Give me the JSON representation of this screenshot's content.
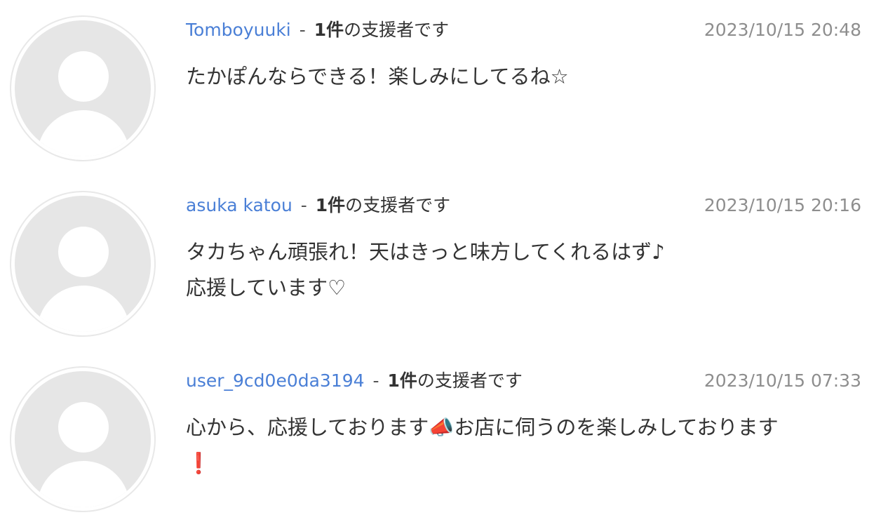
{
  "comments": [
    {
      "username": "Tomboyuuki",
      "separator": "-",
      "count": "1件",
      "supporter_suffix": "の支援者です",
      "timestamp": "2023/10/15 20:48",
      "lines": [
        "たかぽんならできる！楽しみにしてるね☆"
      ]
    },
    {
      "username": "asuka katou",
      "separator": "-",
      "count": "1件",
      "supporter_suffix": "の支援者です",
      "timestamp": "2023/10/15 20:16",
      "lines": [
        "タカちゃん頑張れ！天はきっと味方してくれるはず♪",
        "応援しています♡"
      ]
    },
    {
      "username": "user_9cd0e0da3194",
      "separator": "-",
      "count": "1件",
      "supporter_suffix": "の支援者です",
      "timestamp": "2023/10/15 07:33",
      "lines": [
        "心から、応援しております📣お店に伺うのを楽しみしております",
        "❗"
      ]
    }
  ]
}
